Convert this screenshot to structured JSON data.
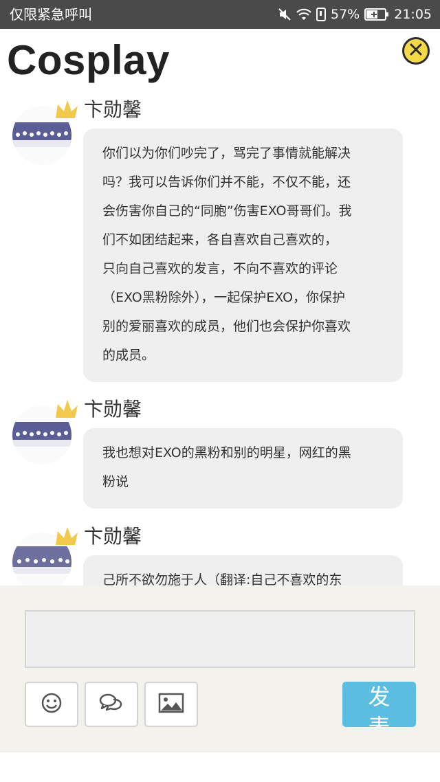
{
  "status_bar": {
    "carrier": "仅限紧急呼叫",
    "battery": "57%",
    "time": "21:05",
    "icons": [
      "mute-icon",
      "wifi-icon",
      "sim-icon",
      "battery-icon"
    ]
  },
  "header": {
    "title": "Cosplay",
    "close_icon": "close-circle-icon"
  },
  "comments": [
    {
      "user": "卞勋馨",
      "text": "你们以为你们吵完了，骂完了事情就能解决\n吗？我可以告诉你们并不能，不仅不能，还\n会伤害你自己的“同胞”伤害EXO哥哥们。我\n们不如团结起来，各自喜欢自己喜欢的，\n只向自己喜欢的发言，不向不喜欢的评论\n（EXO黑粉除外），一起保护EXO，你保护\n别的爱丽喜欢的成员，他们也会保护你喜欢\n的成员。"
    },
    {
      "user": "卞勋馨",
      "text": "我也想对EXO的黑粉和别的明星，网红的黑\n粉说"
    },
    {
      "user": "卞勋馨",
      "text": "己所不欲勿施于人（翻译:自己不喜欢的东"
    }
  ],
  "input_panel": {
    "placeholder": "",
    "tools": [
      "emoji-icon",
      "chat-bubbles-icon",
      "image-icon"
    ],
    "send_label": "发\n表"
  },
  "colors": {
    "status_bar": "#4a4a4a",
    "bubble": "#efefef",
    "panel": "#f3f2ed",
    "send": "#5bbde0",
    "close": "#f5d84a",
    "crown": "#f2c94c"
  }
}
